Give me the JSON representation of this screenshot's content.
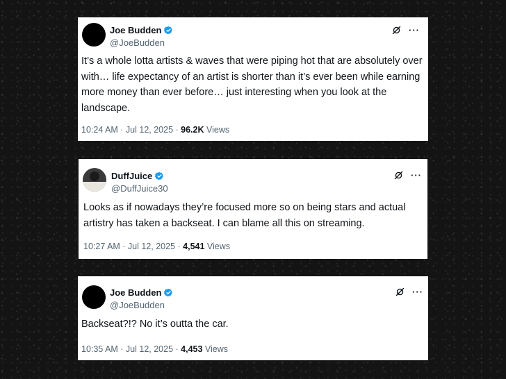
{
  "colors": {
    "background": "#141414",
    "card": "#ffffff",
    "text_primary": "#0f1419",
    "text_secondary": "#536471",
    "verified_blue": "#1d9bf0"
  },
  "tweets": [
    {
      "name": "Joe Budden",
      "handle": "@JoeBudden",
      "avatar_icon": "black-circle-avatar",
      "verified": true,
      "text": "It’s a whole lotta artists & waves that were piping hot that are absolutely over with… life expectancy of an artist is shorter than it’s ever been while earning more money than ever before… just interesting when you look at the landscape.",
      "timestamp": "10:24 AM · Jul 12, 2025 · ",
      "views_count": "96.2K",
      "views_label": " Views",
      "more_label": "···"
    },
    {
      "name": "DuffJuice",
      "handle": "@DuffJuice30",
      "avatar_icon": "profile-photo-avatar",
      "verified": true,
      "text": "Looks as if nowadays they’re focused more so on being stars and actual artistry has taken a backseat. I can blame all this on streaming.",
      "timestamp": "10:27 AM · Jul 12, 2025 · ",
      "views_count": "4,541",
      "views_label": " Views",
      "more_label": "···"
    },
    {
      "name": "Joe Budden",
      "handle": "@JoeBudden",
      "avatar_icon": "black-circle-avatar",
      "verified": true,
      "text": "Backseat?!? No it’s outta the car.",
      "timestamp": "10:35 AM · Jul 12, 2025 · ",
      "views_count": "4,453",
      "views_label": " Views",
      "more_label": "···"
    }
  ]
}
